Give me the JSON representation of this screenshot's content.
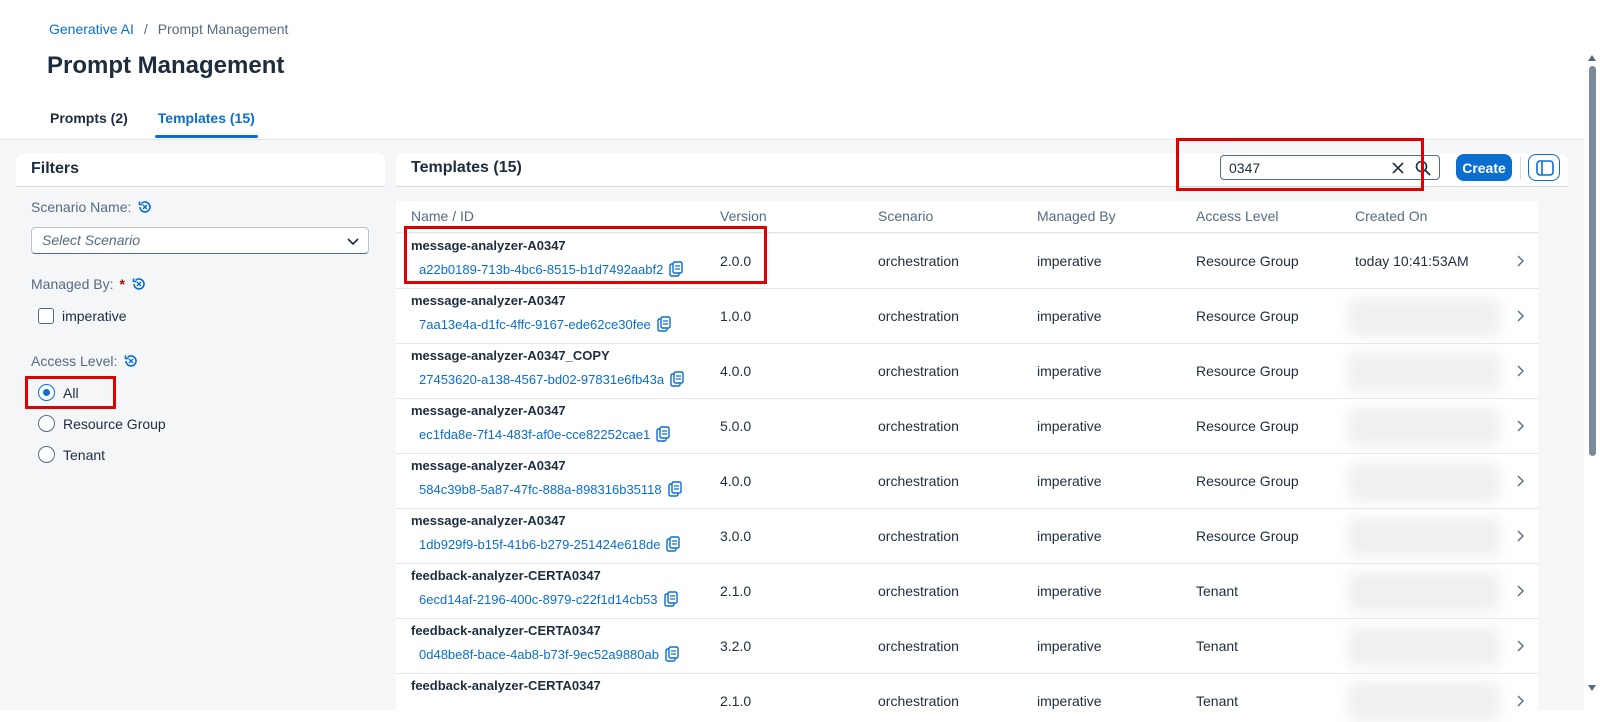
{
  "breadcrumb": {
    "items": [
      "Generative AI",
      "Prompt Management"
    ],
    "separator": "/"
  },
  "page_title": "Prompt Management",
  "tabs": [
    {
      "label": "Prompts (2)"
    },
    {
      "label": "Templates (15)"
    }
  ],
  "filters": {
    "title": "Filters",
    "scenario_label": "Scenario Name:",
    "scenario_placeholder": "Select Scenario",
    "managed_by_label": "Managed By:",
    "required_mark": "*",
    "managed_by_option": "imperative",
    "access_level_label": "Access Level:",
    "access_options": [
      "All",
      "Resource Group",
      "Tenant"
    ],
    "access_selected": "All"
  },
  "table": {
    "title": "Templates (15)",
    "search_value": "0347",
    "create_label": "Create",
    "columns": [
      "Name / ID",
      "Version",
      "Scenario",
      "Managed By",
      "Access Level",
      "Created On"
    ],
    "rows": [
      {
        "name": "message-analyzer-A0347",
        "id": "a22b0189-713b-4bc6-8515-b1d7492aabf2",
        "version": "2.0.0",
        "scenario": "orchestration",
        "managed_by": "imperative",
        "access": "Resource Group",
        "created": "today 10:41:53AM"
      },
      {
        "name": "message-analyzer-A0347",
        "id": "7aa13e4a-d1fc-4ffc-9167-ede62ce30fee",
        "version": "1.0.0",
        "scenario": "orchestration",
        "managed_by": "imperative",
        "access": "Resource Group",
        "created": ""
      },
      {
        "name": "message-analyzer-A0347_COPY",
        "id": "27453620-a138-4567-bd02-97831e6fb43a",
        "version": "4.0.0",
        "scenario": "orchestration",
        "managed_by": "imperative",
        "access": "Resource Group",
        "created": ""
      },
      {
        "name": "message-analyzer-A0347",
        "id": "ec1fda8e-7f14-483f-af0e-cce82252cae1",
        "version": "5.0.0",
        "scenario": "orchestration",
        "managed_by": "imperative",
        "access": "Resource Group",
        "created": ""
      },
      {
        "name": "message-analyzer-A0347",
        "id": "584c39b8-5a87-47fc-888a-898316b35118",
        "version": "4.0.0",
        "scenario": "orchestration",
        "managed_by": "imperative",
        "access": "Resource Group",
        "created": ""
      },
      {
        "name": "message-analyzer-A0347",
        "id": "1db929f9-b15f-41b6-b279-251424e618de",
        "version": "3.0.0",
        "scenario": "orchestration",
        "managed_by": "imperative",
        "access": "Resource Group",
        "created": ""
      },
      {
        "name": "feedback-analyzer-CERTA0347",
        "id": "6ecd14af-2196-400c-8979-c22f1d14cb53",
        "version": "2.1.0",
        "scenario": "orchestration",
        "managed_by": "imperative",
        "access": "Tenant",
        "created": ""
      },
      {
        "name": "feedback-analyzer-CERTA0347",
        "id": "0d48be8f-bace-4ab8-b73f-9ec52a9880ab",
        "version": "3.2.0",
        "scenario": "orchestration",
        "managed_by": "imperative",
        "access": "Tenant",
        "created": ""
      },
      {
        "name": "feedback-analyzer-CERTA0347",
        "id": "",
        "version": "2.1.0",
        "scenario": "orchestration",
        "managed_by": "imperative",
        "access": "Tenant",
        "created": ""
      }
    ]
  },
  "colors": {
    "accent": "#0a6ed1",
    "highlight": "#e00000",
    "text": "#1d2d3e",
    "muted": "#556b82",
    "background": "#f5f6f7"
  }
}
